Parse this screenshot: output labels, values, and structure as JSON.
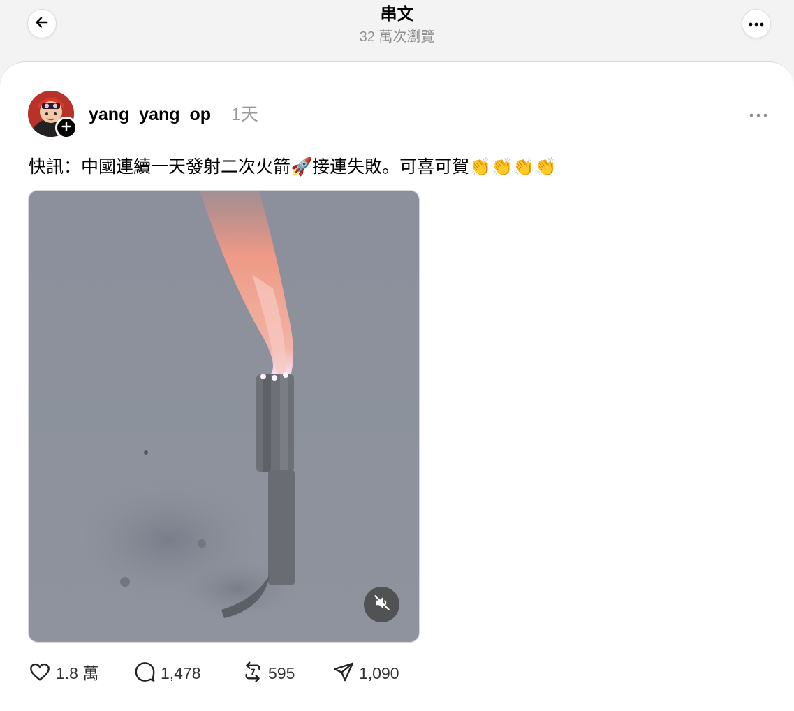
{
  "header": {
    "title": "串文",
    "subtitle": "32 萬次瀏覽",
    "back_icon": "arrow-left-icon",
    "more_icon": "ellipsis-icon"
  },
  "post": {
    "username": "yang_yang_op",
    "timestamp": "1天",
    "text": "快訊：中國連續一天發射二次火箭🚀接連失敗。可喜可賀👏👏👏👏",
    "media": {
      "type": "video",
      "mute_icon": "speaker-muted-icon"
    },
    "actions": {
      "likes": "1.8 萬",
      "replies": "1,478",
      "reposts": "595",
      "shares": "1,090"
    }
  },
  "colors": {
    "background": "#f3f3f3",
    "card": "#ffffff",
    "muted_text": "#9a9a9a",
    "sky": "#8a909b"
  }
}
